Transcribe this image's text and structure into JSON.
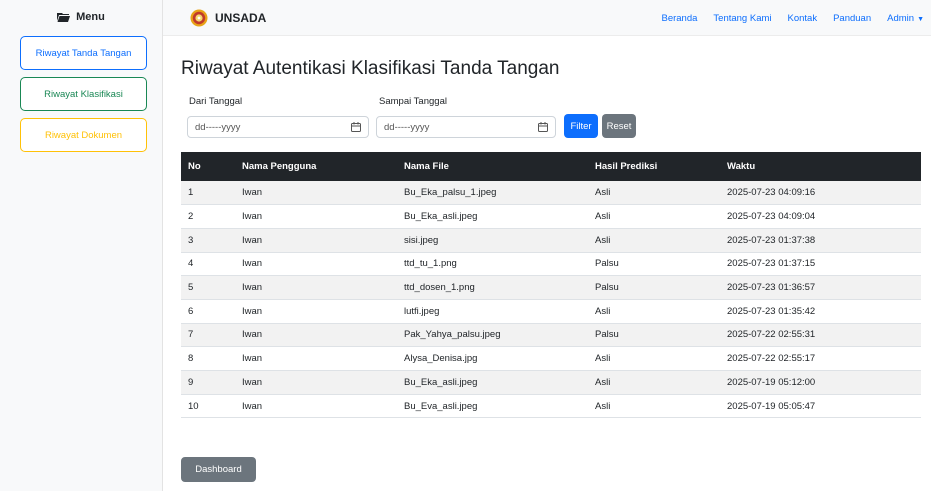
{
  "sidebar": {
    "title": "Menu",
    "buttons": [
      {
        "label": "Riwayat Tanda Tangan"
      },
      {
        "label": "Riwayat Klasifikasi"
      },
      {
        "label": "Riwayat Dokumen"
      }
    ]
  },
  "navbar": {
    "brand": "UNSADA",
    "links": [
      "Beranda",
      "Tentang Kami",
      "Kontak",
      "Panduan",
      "Admin"
    ]
  },
  "main": {
    "title": "Riwayat Autentikasi Klasifikasi Tanda Tangan",
    "from_label": "Dari Tanggal",
    "to_label": "Sampai Tanggal",
    "from_placeholder": "dd-----yyyy",
    "to_placeholder": "dd-----yyyy",
    "filter_label": "Filter",
    "reset_label": "Reset",
    "dashboard_label": "Dashboard"
  },
  "table": {
    "headers": [
      "No",
      "Nama Pengguna",
      "Nama File",
      "Hasil Prediksi",
      "Waktu"
    ],
    "rows": [
      [
        "1",
        "Iwan",
        "Bu_Eka_palsu_1.jpeg",
        "Asli",
        "2025-07-23 04:09:16"
      ],
      [
        "2",
        "Iwan",
        "Bu_Eka_asli.jpeg",
        "Asli",
        "2025-07-23 04:09:04"
      ],
      [
        "3",
        "Iwan",
        "sisi.jpeg",
        "Asli",
        "2025-07-23 01:37:38"
      ],
      [
        "4",
        "Iwan",
        "ttd_tu_1.png",
        "Palsu",
        "2025-07-23 01:37:15"
      ],
      [
        "5",
        "Iwan",
        "ttd_dosen_1.png",
        "Palsu",
        "2025-07-23 01:36:57"
      ],
      [
        "6",
        "Iwan",
        "lutfi.jpeg",
        "Asli",
        "2025-07-23 01:35:42"
      ],
      [
        "7",
        "Iwan",
        "Pak_Yahya_palsu.jpeg",
        "Palsu",
        "2025-07-22 02:55:31"
      ],
      [
        "8",
        "Iwan",
        "Alysa_Denisa.jpg",
        "Asli",
        "2025-07-22 02:55:17"
      ],
      [
        "9",
        "Iwan",
        "Bu_Eka_asli.jpeg",
        "Asli",
        "2025-07-19 05:12:00"
      ],
      [
        "10",
        "Iwan",
        "Bu_Eva_asli.jpeg",
        "Asli",
        "2025-07-19 05:05:47"
      ]
    ]
  },
  "colors": {
    "primary": "#0d6efd",
    "success": "#198754",
    "warning": "#ffc107",
    "secondary": "#6c757d",
    "dark": "#212529"
  },
  "icons": {
    "sidebar": "folder-open-icon",
    "brand": "logo-icon",
    "date": "calendar-icon",
    "admin": "caret-down-icon"
  }
}
